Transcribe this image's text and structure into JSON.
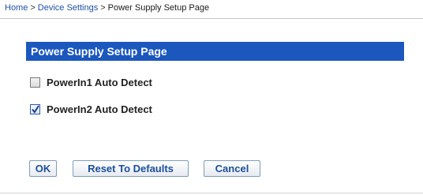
{
  "breadcrumb": {
    "home": "Home",
    "device_settings": "Device Settings",
    "current": "Power Supply Setup Page",
    "separator": ">"
  },
  "panel": {
    "title": "Power Supply Setup Page"
  },
  "options": [
    {
      "label": "PowerIn1 Auto Detect",
      "checked": false
    },
    {
      "label": "PowerIn2 Auto Detect",
      "checked": true
    }
  ],
  "buttons": {
    "ok": "OK",
    "reset": "Reset To Defaults",
    "cancel": "Cancel"
  },
  "colors": {
    "header_bg": "#1b57bd",
    "link": "#1f4fa8",
    "button_text": "#1b4f9c"
  }
}
